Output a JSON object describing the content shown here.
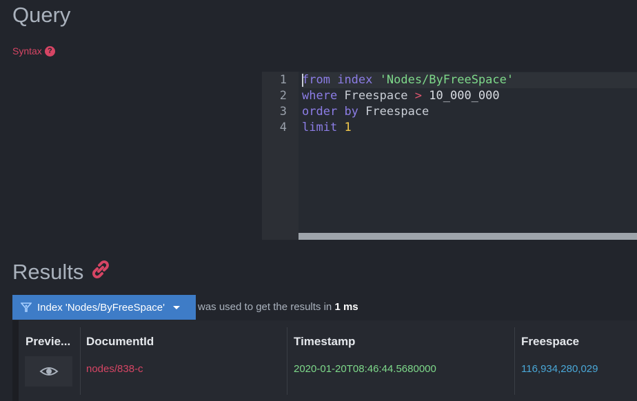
{
  "query": {
    "title": "Query",
    "syntax_label": "Syntax",
    "help_icon": "question-circle-icon",
    "editor": {
      "line_numbers": [
        "1",
        "2",
        "3",
        "4"
      ],
      "lines": [
        [
          {
            "t": "from",
            "c": "kw"
          },
          {
            "t": " ",
            "c": "id"
          },
          {
            "t": "index",
            "c": "kw"
          },
          {
            "t": " ",
            "c": "id"
          },
          {
            "t": "'Nodes/ByFreeSpace'",
            "c": "str"
          }
        ],
        [
          {
            "t": "where",
            "c": "kw"
          },
          {
            "t": " Freespace ",
            "c": "id"
          },
          {
            "t": ">",
            "c": "op"
          },
          {
            "t": " 10_000_000",
            "c": "num"
          }
        ],
        [
          {
            "t": "order",
            "c": "kw"
          },
          {
            "t": " ",
            "c": "id"
          },
          {
            "t": "by",
            "c": "kw"
          },
          {
            "t": " Freespace",
            "c": "id"
          }
        ],
        [
          {
            "t": "limit",
            "c": "kw"
          },
          {
            "t": " ",
            "c": "id"
          },
          {
            "t": "1",
            "c": "num2"
          }
        ]
      ]
    }
  },
  "results": {
    "title": "Results",
    "link_icon": "link-icon",
    "index_button_label": "Index 'Nodes/ByFreeSpace'",
    "used_text": "was used to get the results in",
    "duration": "1 ms",
    "columns": [
      "Previe...",
      "DocumentId",
      "Timestamp",
      "Freespace"
    ],
    "rows": [
      {
        "documentId": "nodes/838-c",
        "timestamp": "2020-01-20T08:46:44.5680000",
        "freespace": "116,934,280,029"
      }
    ]
  },
  "colors": {
    "background": "#22252c",
    "accent": "#d64564",
    "button": "#3e7cc7",
    "keyword": "#8c7de6",
    "string": "#7ed98a"
  }
}
